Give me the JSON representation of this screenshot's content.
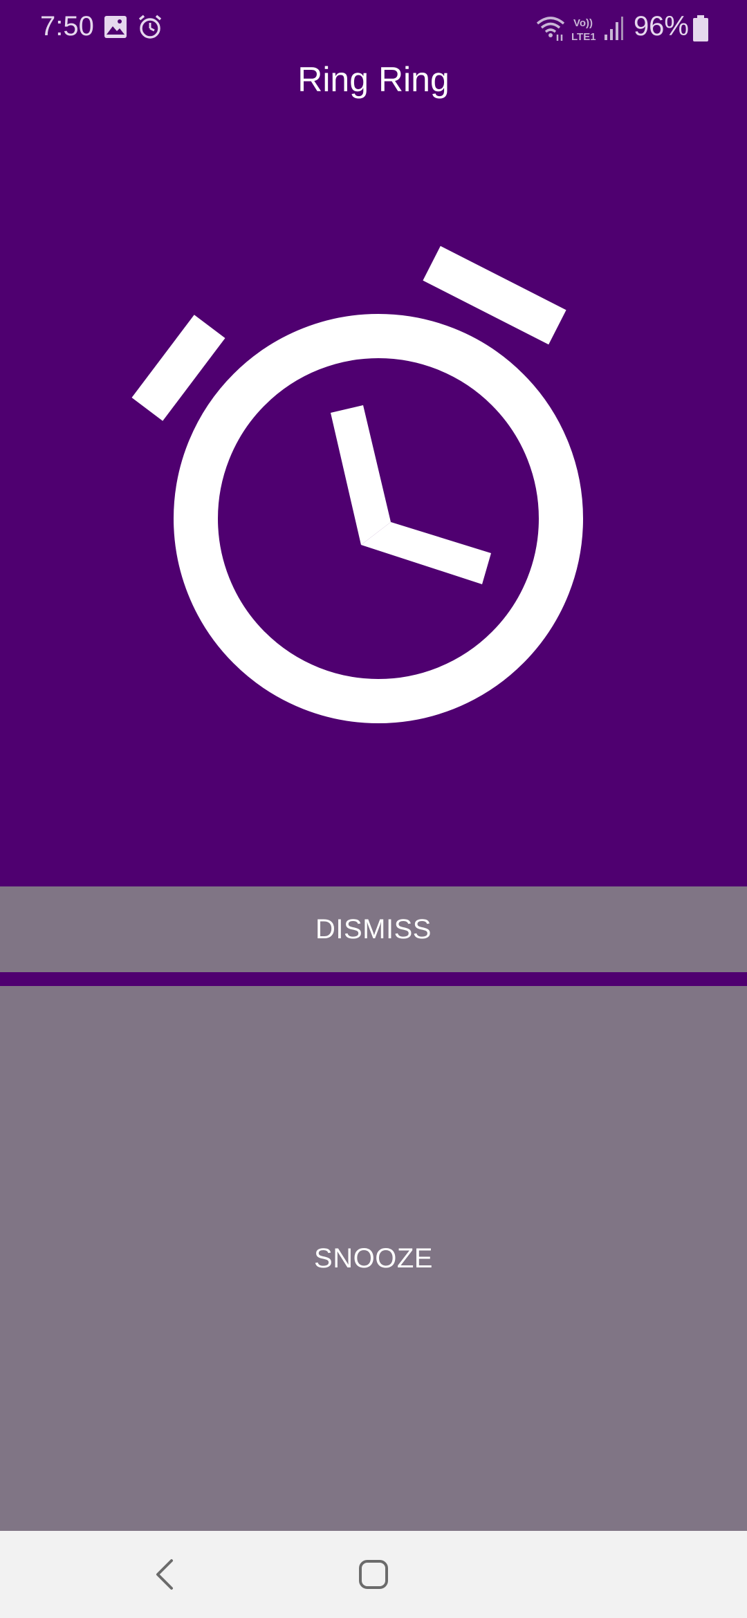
{
  "status_bar": {
    "time": "7:50",
    "icons": [
      "gallery-icon",
      "alarm-clock-icon",
      "wifi-icon",
      "volte-lte1-icon",
      "signal-icon",
      "battery-icon"
    ],
    "volte_label_top": "Vo))",
    "volte_label_bottom": "LTE1",
    "battery_percent": "96%"
  },
  "header": {
    "title": "Ring Ring"
  },
  "illustration": {
    "icon": "alarm-clock-icon"
  },
  "actions": {
    "dismiss_label": "DISMISS",
    "snooze_label": "SNOOZE"
  },
  "navigation": {
    "icons": [
      "back-icon",
      "home-icon"
    ]
  },
  "colors": {
    "background": "#4f0070",
    "button": "#807585",
    "button_text": "#ffffff",
    "nav_bar": "#f2f2f2"
  }
}
